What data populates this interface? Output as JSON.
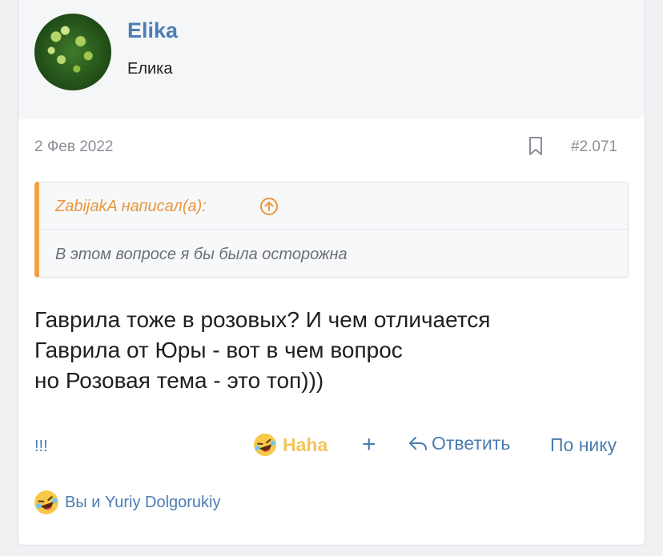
{
  "user": {
    "name": "Elika",
    "title": "Елика"
  },
  "post": {
    "date": "2 Фев 2022",
    "number": "#2.071"
  },
  "quote": {
    "author": "ZabijakA написал(а):",
    "text": "В этом вопросе я бы была осторожна"
  },
  "message": {
    "lines": [
      "Гаврила тоже в розовых? И чем отличается",
      "Гаврила от Юры - вот в чем вопрос",
      "но Розовая тема - это топ)))"
    ]
  },
  "actions": {
    "flag": "!!!",
    "reaction": "Haha",
    "add": "+",
    "reply": "Ответить",
    "nick": "По нику"
  },
  "reactions_summary": {
    "text": "Вы и Yuriy Dolgorukiy"
  },
  "icons": {
    "bookmark": "bookmark-icon",
    "quote_jump": "arrow-up-circle-icon",
    "reaction": "laughing-emoji-icon",
    "reply": "reply-arrow-icon"
  },
  "colors": {
    "link": "#4b7db4",
    "quote_accent": "#f0a244",
    "haha": "#f3c55a"
  }
}
